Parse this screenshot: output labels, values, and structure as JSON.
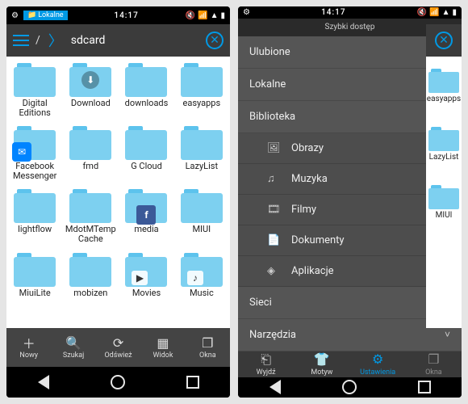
{
  "statusbar": {
    "time": "14:17",
    "chip_label": "Lokalne"
  },
  "left": {
    "path_root": "/",
    "path_current": "sdcard",
    "cut_top": "",
    "folders": [
      {
        "label": "Digital Editions",
        "overlay": null
      },
      {
        "label": "Download",
        "overlay": "dl"
      },
      {
        "label": "downloads",
        "overlay": null
      },
      {
        "label": "easyapps",
        "overlay": null
      },
      {
        "label": "Facebook Messenger",
        "overlay": "fb"
      },
      {
        "label": "fmd",
        "overlay": null
      },
      {
        "label": "G Cloud",
        "overlay": null
      },
      {
        "label": "LazyList",
        "overlay": null
      },
      {
        "label": "lightflow",
        "overlay": null
      },
      {
        "label": "MdotMTempCache",
        "overlay": null
      },
      {
        "label": "media",
        "overlay": "fbk"
      },
      {
        "label": "MIUI",
        "overlay": null
      },
      {
        "label": "MiuiLite",
        "overlay": null
      },
      {
        "label": "mobizen",
        "overlay": null
      },
      {
        "label": "Movies",
        "overlay": "play"
      },
      {
        "label": "Music",
        "overlay": "music"
      }
    ],
    "bottombar": [
      {
        "label": "Nowy",
        "icon": "+"
      },
      {
        "label": "Szukaj",
        "icon": "search"
      },
      {
        "label": "Odśwież",
        "icon": "refresh"
      },
      {
        "label": "Widok",
        "icon": "grid"
      },
      {
        "label": "Okna",
        "icon": "windows"
      }
    ]
  },
  "right": {
    "drawer_title": "Szybki dostęp",
    "sections": [
      {
        "label": "Ulubione",
        "expanded": false
      },
      {
        "label": "Lokalne",
        "expanded": false
      },
      {
        "label": "Biblioteka",
        "expanded": true,
        "items": [
          {
            "label": "Obrazy",
            "icon": "image"
          },
          {
            "label": "Muzyka",
            "icon": "music"
          },
          {
            "label": "Filmy",
            "icon": "film"
          },
          {
            "label": "Dokumenty",
            "icon": "doc"
          },
          {
            "label": "Aplikacje",
            "icon": "app"
          }
        ]
      },
      {
        "label": "Sieci",
        "expanded": false
      },
      {
        "label": "Narzędzia",
        "expanded": false
      }
    ],
    "strip_folders": [
      "easyapps",
      "LazyList",
      "MIUI"
    ],
    "bottombar": [
      {
        "label": "Wyjdź",
        "icon": "exit"
      },
      {
        "label": "Motyw",
        "icon": "theme"
      },
      {
        "label": "Ustawienia",
        "icon": "gear"
      },
      {
        "label": "Okna",
        "icon": "windows"
      }
    ]
  }
}
